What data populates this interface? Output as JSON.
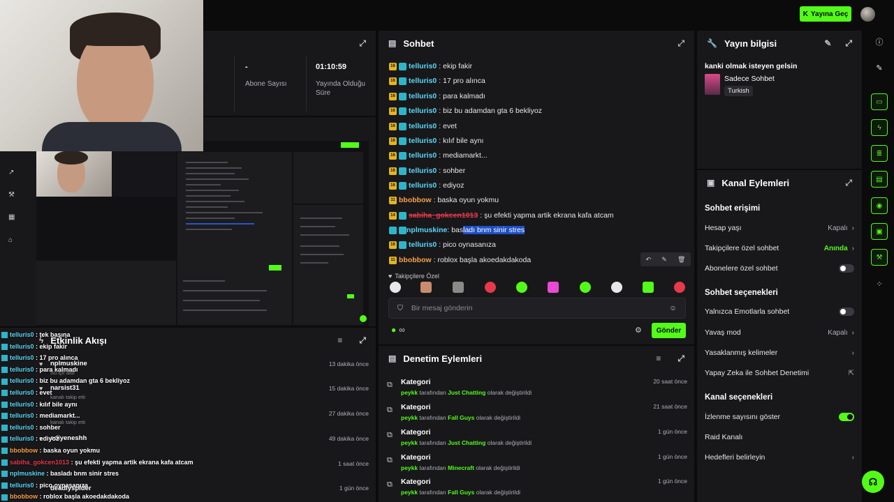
{
  "topbar": {
    "go_live": "Yayına Geç"
  },
  "stats": {
    "subs_value": "-",
    "subs_label": "Abone Sayısı",
    "uptime_value": "01:10:59",
    "uptime_label_1": "Yayında Olduğu",
    "uptime_label_2": "Süre"
  },
  "chat": {
    "title": "Sohbet",
    "messages": [
      {
        "badge": "16",
        "user": "telluris0",
        "text": ": ekip fakir",
        "user_color": "#5dd6f5"
      },
      {
        "badge": "16",
        "user": "telluris0",
        "text": ": 17 pro alınca",
        "user_color": "#5dd6f5"
      },
      {
        "badge": "16",
        "user": "telluris0",
        "text": ": para kalmadı",
        "user_color": "#5dd6f5"
      },
      {
        "badge": "16",
        "user": "telluris0",
        "text": ": biz bu adamdan gta 6 bekliyoz",
        "user_color": "#5dd6f5"
      },
      {
        "badge": "16",
        "user": "telluris0",
        "text": ": evet",
        "user_color": "#5dd6f5"
      },
      {
        "badge": "16",
        "user": "telluris0",
        "text": ": kılıf bile aynı",
        "user_color": "#5dd6f5"
      },
      {
        "badge": "16",
        "user": "telluris0",
        "text": ": mediamarkt...",
        "user_color": "#5dd6f5"
      },
      {
        "badge": "16",
        "user": "telluris0",
        "text": ": sohber",
        "user_color": "#5dd6f5"
      },
      {
        "badge": "16",
        "user": "telluris0",
        "text": ": ediyoz",
        "user_color": "#5dd6f5"
      },
      {
        "badge": "11",
        "user": "bbobbow",
        "text": ": baska oyun yokmu",
        "user_color": "#f7a14a"
      },
      {
        "badge": "14",
        "user": "sabiha_gokcen1013",
        "text": ": şu efekti yapma artik ekrana kafa atcam",
        "user_color": "#e6394a"
      },
      {
        "badge": "",
        "user": "nplmuskine",
        "text_plain": ": bas",
        "text_hl": "ladı bnm sinir stres",
        "user_color": "#5dd6f5"
      },
      {
        "badge": "16",
        "user": "telluris0",
        "text": ": pico oynasanıza",
        "user_color": "#5dd6f5"
      },
      {
        "badge": "11",
        "user": "bbobbow",
        "text": ": roblox başla akoedakdakoda",
        "user_color": "#f7a14a"
      }
    ],
    "followers_only": "Takipçilere Özel",
    "placeholder": "Bir mesaj gönderin",
    "send": "Gönder",
    "infinity": "∞"
  },
  "mod": {
    "title": "Denetim Eylemleri",
    "items": [
      {
        "title": "Kategori",
        "user": "peykk",
        "mid": " tarafından ",
        "cat": "Just Chatting",
        "tail": " olarak değiştirildi",
        "time": "20 saat önce"
      },
      {
        "title": "Kategori",
        "user": "peykk",
        "mid": " tarafından ",
        "cat": "Fall Guys",
        "tail": " olarak değiştirildi",
        "time": "21 saat önce"
      },
      {
        "title": "Kategori",
        "user": "peykk",
        "mid": " tarafından ",
        "cat": "Just Chatting",
        "tail": " olarak değiştirildi",
        "time": "1 gün önce"
      },
      {
        "title": "Kategori",
        "user": "peykk",
        "mid": " tarafından ",
        "cat": "Minecraft",
        "tail": " olarak değiştirildi",
        "time": "1 gün önce"
      },
      {
        "title": "Kategori",
        "user": "peykk",
        "mid": " tarafından ",
        "cat": "Fall Guys",
        "tail": " olarak değiştirildi",
        "time": "1 gün önce"
      }
    ]
  },
  "feed": {
    "title": "Etkinlik Akışı",
    "items": [
      {
        "user": "nplmuskine",
        "sub": "Su içir aldı",
        "time": "13 dakika önce"
      },
      {
        "user": "narsist31",
        "sub": "kanalı takip etti",
        "time": "15 dakika önce"
      },
      {
        "user": "",
        "sub": "kanalı takip etti",
        "time": "27 dakika önce"
      },
      {
        "user": "ediyeneshh",
        "sub": "",
        "time": "49 dakika önce"
      },
      {
        "user": "",
        "sub": "",
        "time": "1 saat önce"
      },
      {
        "user": "",
        "sub": "",
        "time": "1 gün önce"
      }
    ],
    "overlay": [
      {
        "u": "telluris0",
        "t": " : tek başına",
        "c": "#5dd6f5"
      },
      {
        "u": "telluris0",
        "t": " : ekip fakir",
        "c": "#5dd6f5"
      },
      {
        "u": "telluris0",
        "t": " : 17 pro alınca",
        "c": "#5dd6f5"
      },
      {
        "u": "telluris0",
        "t": " : para kalmadı",
        "c": "#5dd6f5"
      },
      {
        "u": "telluris0",
        "t": " : biz bu adamdan gta 6 bekliyoz",
        "c": "#5dd6f5"
      },
      {
        "u": "telluris0",
        "t": " : evet",
        "c": "#5dd6f5"
      },
      {
        "u": "telluris0",
        "t": " : kılıf bile aynı",
        "c": "#5dd6f5"
      },
      {
        "u": "telluris0",
        "t": " : mediamarkt...",
        "c": "#5dd6f5"
      },
      {
        "u": "telluris0",
        "t": " : sohber",
        "c": "#5dd6f5"
      },
      {
        "u": "telluris0",
        "t": " : ediyoz",
        "c": "#5dd6f5"
      },
      {
        "u": "bbobbow",
        "t": " : baska oyun yokmu",
        "c": "#f7a14a"
      },
      {
        "u": "sabiha_gokcen1013",
        "t": " : şu efekti yapma artik ekrana kafa atcam",
        "c": "#e6394a"
      },
      {
        "u": "nplmuskine",
        "t": " : basladı bnm sinir stres",
        "c": "#5dd6f5"
      },
      {
        "u": "telluris0",
        "t": " : pico oynasanıza",
        "c": "#5dd6f5"
      },
      {
        "u": "bbobbow",
        "t": " : roblox başla akoedakdakoda",
        "c": "#f7a14a"
      }
    ],
    "overlay_extra": "deadiyspider"
  },
  "stream_info": {
    "title": "Yayın bilgisi",
    "stream_title": "kanki olmak isteyen gelsin",
    "category": "Sadece Sohbet",
    "language": "Turkish"
  },
  "channel_actions": {
    "title": "Kanal Eylemleri",
    "chat_access": "Sohbet erişimi",
    "account_age": "Hesap yaşı",
    "account_age_val": "Kapalı",
    "followers_chat": "Takipçilere özel sohbet",
    "followers_chat_val": "Anında",
    "subs_chat": "Abonelere özel sohbet",
    "chat_options": "Sohbet seçenekleri",
    "emote_only": "Yalnızca Emotlarla sohbet",
    "slow_mode": "Yavaş mod",
    "slow_mode_val": "Kapalı",
    "banned_words": "Yasaklanmış kelimeler",
    "ai_mod": "Yapay Zeka ile Sohbet Denetimi",
    "channel_options": "Kanal seçenekleri",
    "show_viewers": "İzlenme sayısını göster",
    "raid": "Raid Kanalı",
    "goals": "Hedefleri belirleyin"
  },
  "colors": {
    "accent": "#53fc18",
    "panel": "#18181b",
    "bg": "#0b0b0c"
  }
}
